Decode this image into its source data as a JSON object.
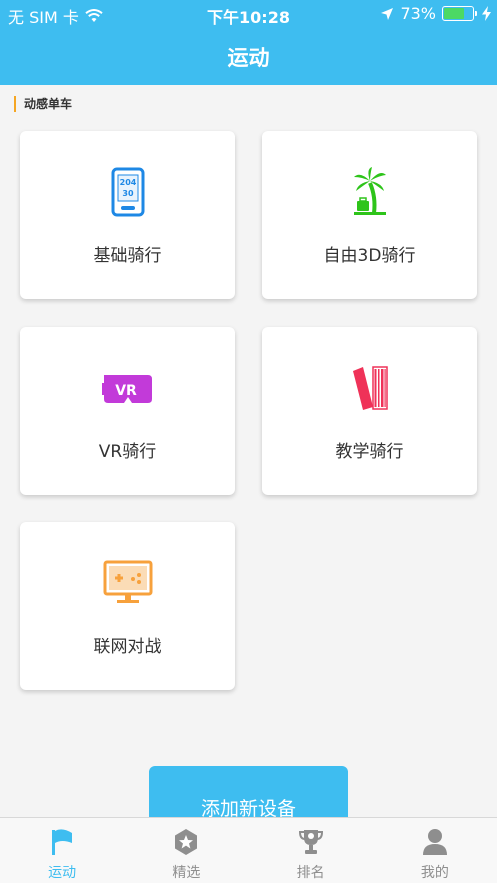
{
  "status_bar": {
    "carrier": "无 SIM 卡",
    "time": "下午10:28",
    "battery_percent": "73%",
    "battery_level": 0.73,
    "icons": [
      "wifi-icon",
      "location-arrow-icon",
      "battery-icon",
      "charging-bolt-icon"
    ]
  },
  "header": {
    "title": "运动"
  },
  "section": {
    "label": "动感单车"
  },
  "cards": [
    {
      "label": "基础骑行",
      "icon": "phone-meter-icon",
      "color": "#1e88e5"
    },
    {
      "label": "自由3D骑行",
      "icon": "palm-tree-icon",
      "color": "#2ec41a"
    },
    {
      "label": "VR骑行",
      "icon": "vr-headset-icon",
      "color": "#c23ad9"
    },
    {
      "label": "教学骑行",
      "icon": "books-icon",
      "color": "#ef3258"
    },
    {
      "label": "联网对战",
      "icon": "game-screen-icon",
      "color": "#f7a13c"
    }
  ],
  "phone_icon_text": {
    "line1": "204",
    "line2": "30"
  },
  "vr_icon_text": "VR",
  "add_device": {
    "label": "添加新设备"
  },
  "tabs": [
    {
      "label": "运动",
      "icon": "flag-icon",
      "active": true
    },
    {
      "label": "精选",
      "icon": "star-badge-icon",
      "active": false
    },
    {
      "label": "排名",
      "icon": "trophy-icon",
      "active": false
    },
    {
      "label": "我的",
      "icon": "person-icon",
      "active": false
    }
  ],
  "colors": {
    "primary": "#3ebdf0",
    "accent_bar": "#f5a623",
    "tab_inactive": "#8e8e8e"
  }
}
